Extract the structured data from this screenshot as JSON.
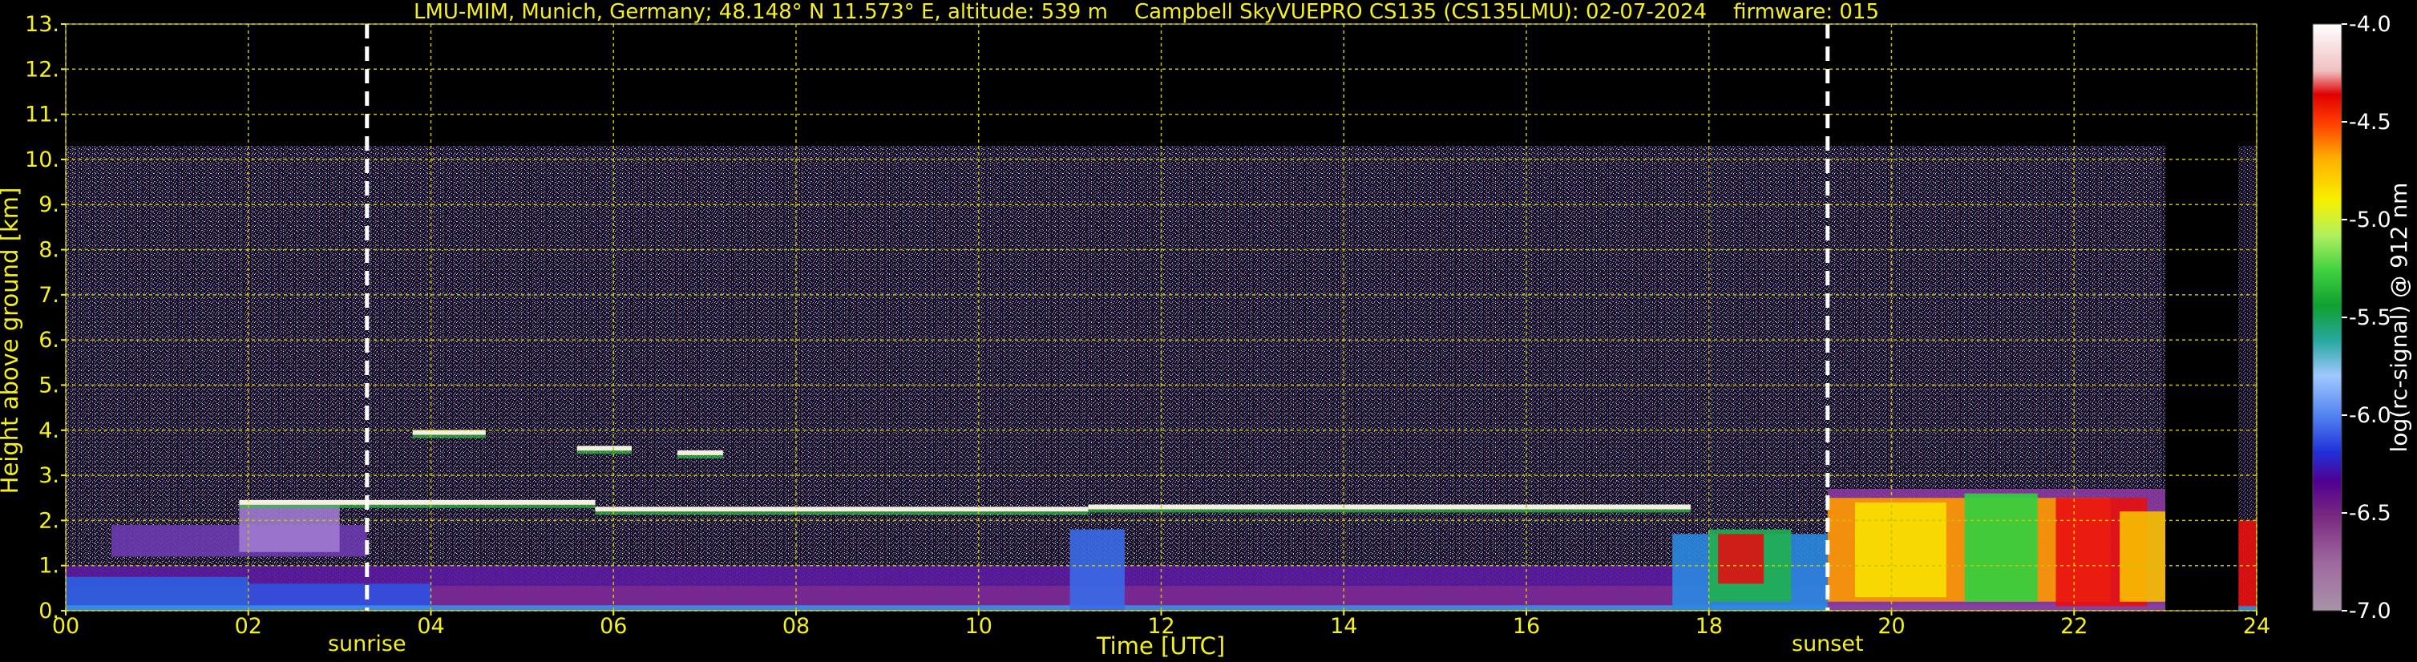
{
  "chart_data": {
    "type": "heatmap",
    "title": "LMU-MIM, Munich, Germany; 48.148° N 11.573° E, altitude: 539 m    Campbell SkyVUEPRO CS135 (CS135LMU): 02-07-2024    firmware: 015",
    "xlabel": "Time [UTC]",
    "ylabel": "Height above ground [km]",
    "xlim": [
      0,
      24
    ],
    "ylim": [
      0,
      13
    ],
    "xticks": [
      "00",
      "02",
      "04",
      "06",
      "08",
      "10",
      "12",
      "14",
      "16",
      "18",
      "20",
      "22",
      "24"
    ],
    "xtick_values": [
      0,
      2,
      4,
      6,
      8,
      10,
      12,
      14,
      16,
      18,
      20,
      22,
      24
    ],
    "yticks": [
      "0.",
      "1.",
      "2.",
      "3.",
      "4.",
      "5.",
      "6.",
      "7.",
      "8.",
      "9.",
      "10.",
      "11.",
      "12.",
      "13."
    ],
    "ytick_values": [
      0,
      1,
      2,
      3,
      4,
      5,
      6,
      7,
      8,
      9,
      10,
      11,
      12,
      13
    ],
    "grid": true,
    "colorbar": {
      "label": "log(rc-signal) @ 912 nm",
      "range": [
        -7.0,
        -4.0
      ],
      "ticks": [
        "-4.0",
        "-4.5",
        "-5.0",
        "-5.5",
        "-6.0",
        "-6.5",
        "-7.0"
      ],
      "tick_values": [
        -4.0,
        -4.5,
        -5.0,
        -5.5,
        -6.0,
        -6.5,
        -7.0
      ]
    },
    "annotations": [
      {
        "text": "sunrise",
        "x": 3.3
      },
      {
        "text": "sunset",
        "x": 19.3
      }
    ],
    "features": {
      "data_top_km": 10.3,
      "no_data_gap_hours": [
        23.0,
        23.8
      ],
      "cloud_layers": [
        {
          "t0": 1.9,
          "t1": 5.8,
          "h": 2.4
        },
        {
          "t0": 5.8,
          "t1": 11.2,
          "h": 2.25
        },
        {
          "t0": 11.2,
          "t1": 17.8,
          "h": 2.3
        },
        {
          "t0": 3.8,
          "t1": 4.6,
          "h": 3.95
        },
        {
          "t0": 5.6,
          "t1": 6.2,
          "h": 3.6
        },
        {
          "t0": 6.7,
          "t1": 7.2,
          "h": 3.5
        }
      ]
    }
  },
  "colors": {
    "text": "#f5f01c",
    "grid": "#c9c400",
    "marker_line": "#ffffff",
    "background": "#000000"
  }
}
